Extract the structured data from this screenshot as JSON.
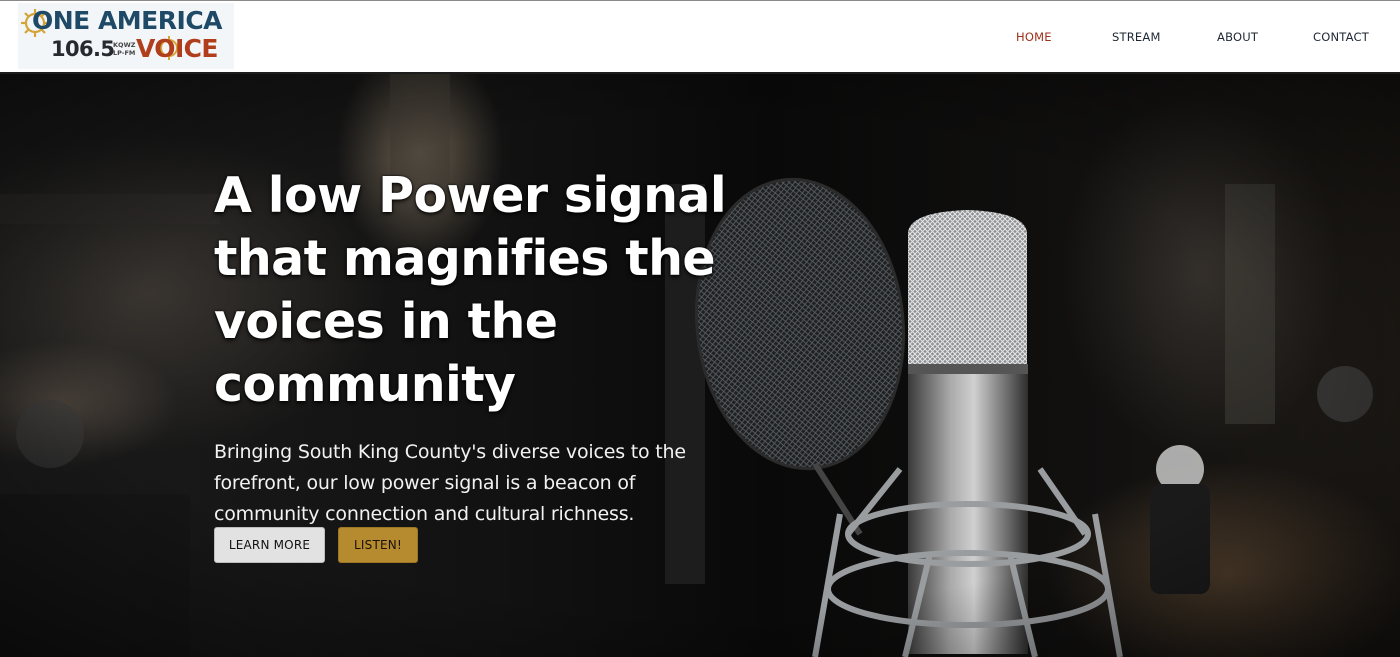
{
  "brand": {
    "line1": "ONE AMERICA",
    "frequency": "106.5",
    "callsign_top": "KQWZ",
    "callsign_bottom": "LP-FM",
    "line2": "VOICE",
    "colors": {
      "navy": "#1f4a67",
      "orange": "#b03e1d",
      "gold": "#d4a437"
    }
  },
  "nav": {
    "items": [
      {
        "label": "HOME",
        "active": true
      },
      {
        "label": "STREAM",
        "active": false
      },
      {
        "label": "ABOUT",
        "active": false
      },
      {
        "label": "CONTACT",
        "active": false
      }
    ],
    "active_color": "#a1301a"
  },
  "hero": {
    "headline": "A low Power signal that magnifies the voices in the community",
    "subtext": "Bringing South King County's diverse voices to the forefront, our low power signal is a beacon of community connection and cultural richness.",
    "buttons": {
      "learn_more": "LEARN MORE",
      "listen": "LISTEN!"
    },
    "background_icon": "studio-microphone-photo"
  }
}
